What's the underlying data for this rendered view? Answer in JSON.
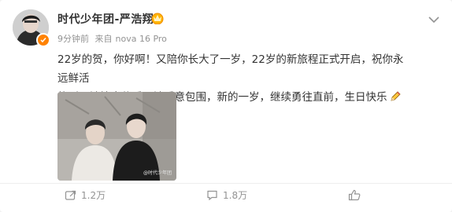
{
  "post": {
    "author": "时代少年团-严浩翔",
    "time": "9分钟前",
    "source_prefix": "来自",
    "device": "nova 16 Pro",
    "text_line1": "22岁的贺，你好啊！又陪你长大了一岁，22岁的新旅程正式开启，祝你永远鲜活",
    "text_line2": "热烈，被惊喜偏爱，被爱意包围，新的一岁，继续勇往直前，生日快乐",
    "photo_watermark": "@时代少年团"
  },
  "actions": {
    "repost_count": "1.2万",
    "comment_count": "1.8万"
  },
  "colors": {
    "verify": "#ff8200",
    "text": "#333333",
    "meta": "#939393"
  },
  "icons": [
    "more-icon",
    "verified-icon",
    "vip-crown-icon",
    "pencil-emoji-icon",
    "repost-icon",
    "comment-icon",
    "like-icon"
  ]
}
